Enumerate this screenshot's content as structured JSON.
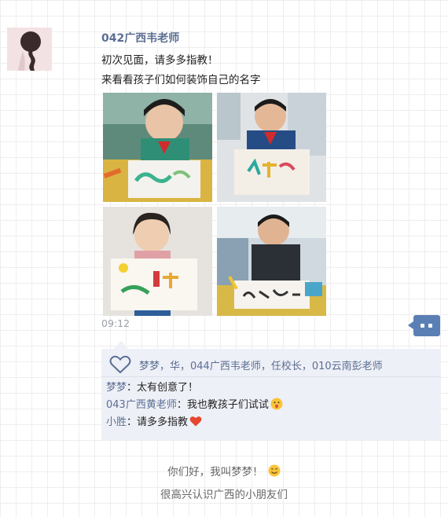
{
  "post": {
    "author": "042广西韦老师",
    "text_line1": "初次见面，请多多指教！",
    "text_line2": "来看看孩子们如何装饰自己的名字",
    "photos": [
      {
        "icon": "child-drawing-photo"
      },
      {
        "icon": "child-holding-drawing-photo"
      },
      {
        "icon": "girl-holding-drawing-photo"
      },
      {
        "icon": "boy-writing-photo"
      }
    ],
    "time": "09:12"
  },
  "likes": {
    "icon": "heart-icon",
    "names": "梦梦，华，044广西韦老师，任校长，010云南彭老师"
  },
  "comments": [
    {
      "author": "梦梦",
      "separator": "：",
      "text": "太有创意了！",
      "emoji": ""
    },
    {
      "author": "043广西黄老师",
      "separator": "：",
      "text": "我也教孩子们试试",
      "emoji": "😮"
    },
    {
      "author": "小胜",
      "separator": "：",
      "text": "请多多指教",
      "emoji": "❤"
    }
  ],
  "replies": {
    "line1": "你们好，我叫梦梦！",
    "line1_emoji": "😊",
    "line2": "很高兴认识广西的小朋友们"
  },
  "colors": {
    "name_blue": "#5b6e93",
    "comment_button": "#5a7fb4",
    "panel_bg": "#eef0f7"
  }
}
